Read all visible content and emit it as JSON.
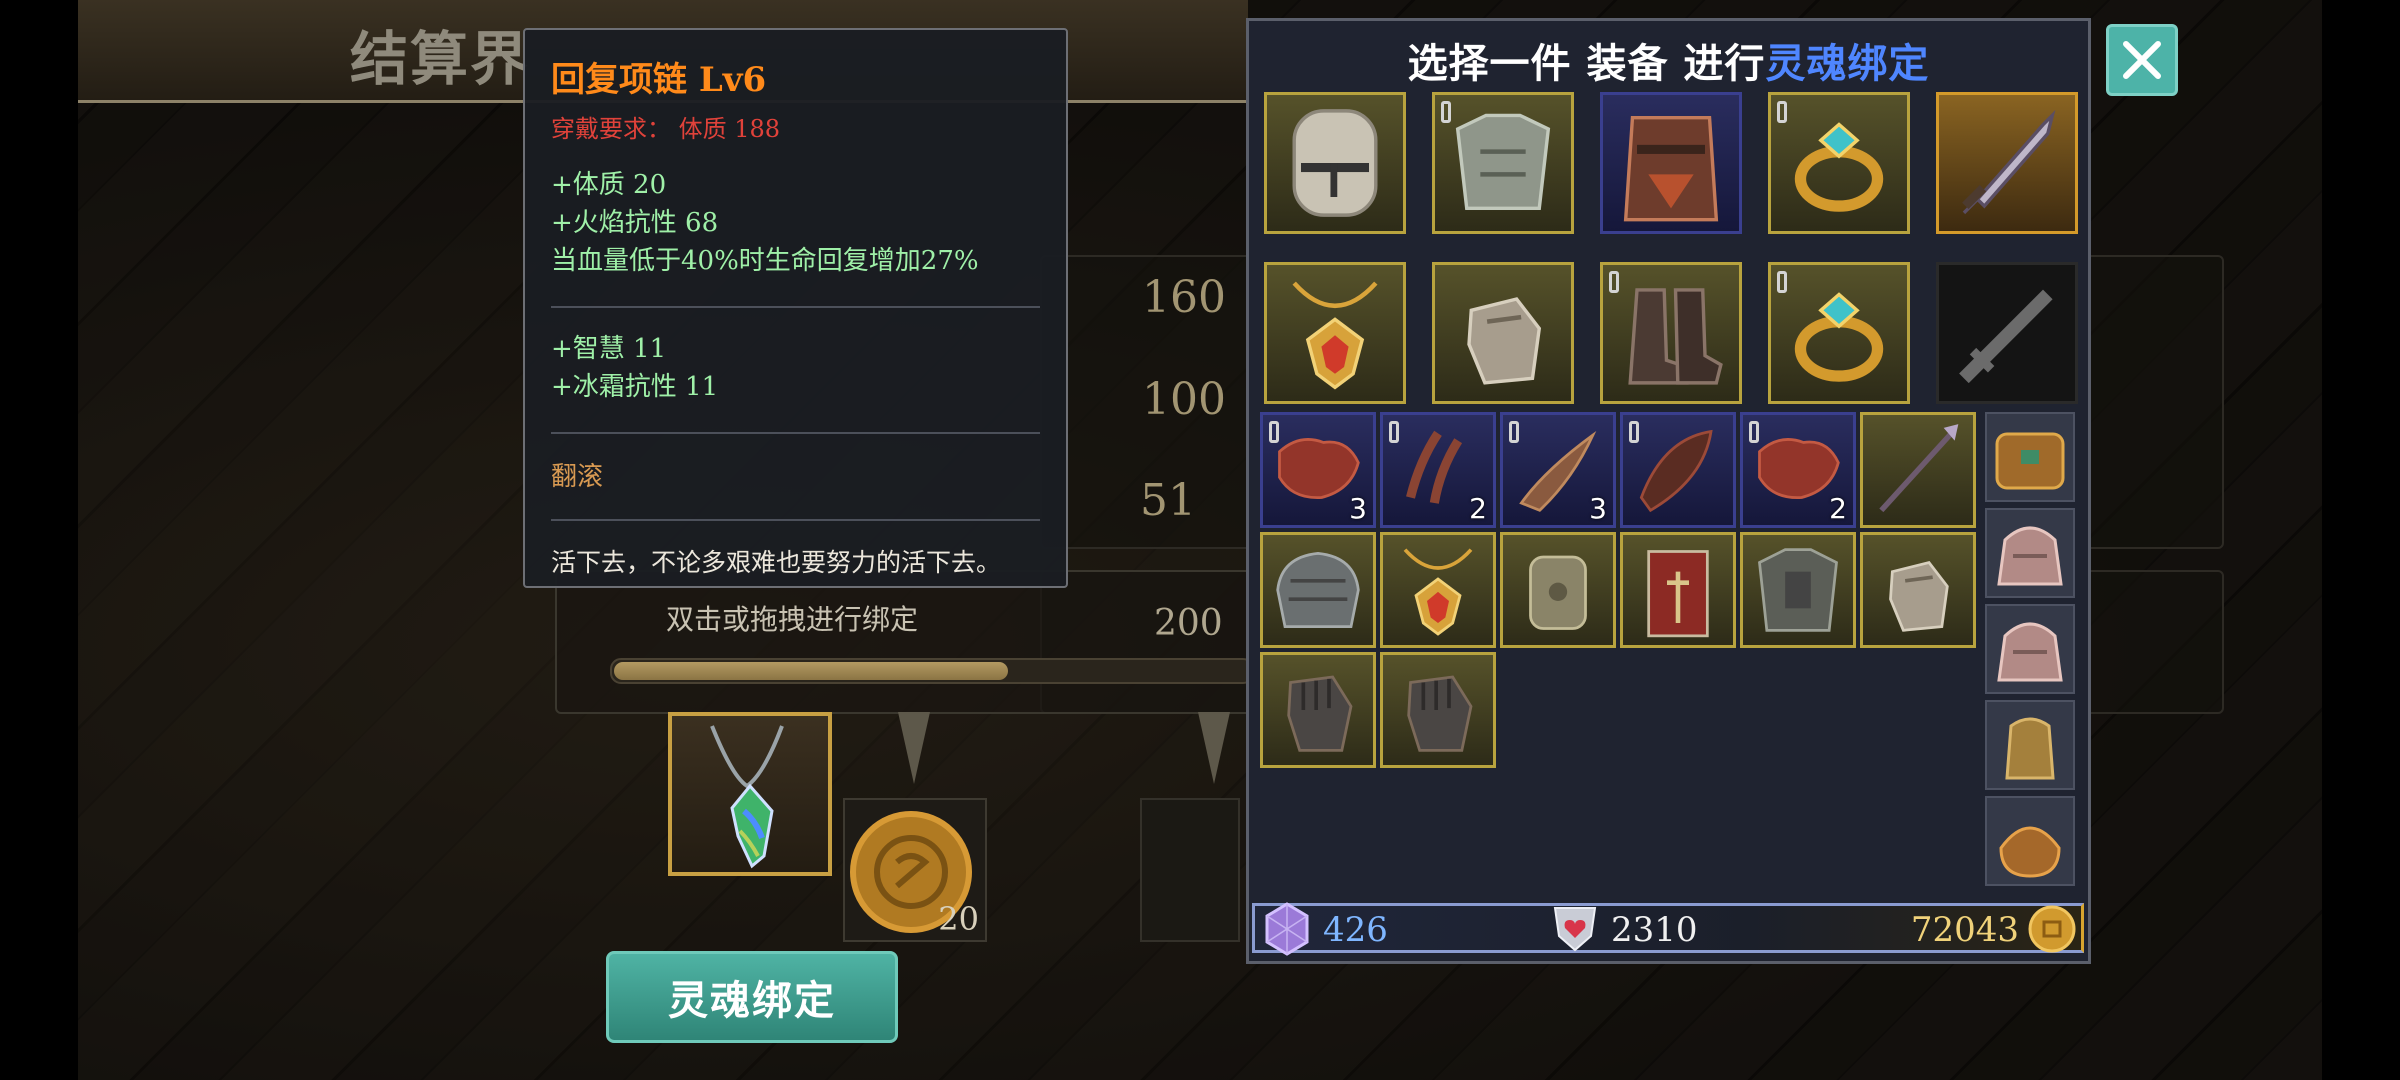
{
  "background_screen": {
    "title": "结算界",
    "numbers": [
      "160",
      "100",
      "51"
    ],
    "bind_hint": "双击或拖拽进行绑定",
    "progress_label": "200",
    "progress_fraction": 0.62,
    "coin_count": "20",
    "soul_bind_button": "灵魂绑定"
  },
  "tooltip": {
    "title": "回复项链  Lv6",
    "requirement": "穿戴要求：  体质  188",
    "stats": [
      "+体质  20",
      "+火焰抗性  68",
      "当血量低于40%时生命回复增加27%"
    ],
    "bonus_stats": [
      "+智慧  11",
      "+冰霜抗性  11"
    ],
    "skill": "翻滚",
    "flavor": "活下去，不论多艰难也要努力的活下去。"
  },
  "panel": {
    "title_prefix": "选择一件  装备  进行",
    "title_highlight": "灵魂绑定",
    "equipped": [
      {
        "icon": "great-helm-icon",
        "style": "olive"
      },
      {
        "icon": "chest-armor-icon",
        "style": "olive",
        "locked": true
      },
      {
        "icon": "leather-armor-icon",
        "style": "blue"
      },
      {
        "icon": "gem-ring-icon",
        "style": "olive",
        "locked": true
      },
      {
        "icon": "greatsword-icon",
        "style": "gold"
      },
      {
        "icon": "ruby-amulet-icon",
        "style": "olive"
      },
      {
        "icon": "gauntlet-icon",
        "style": "olive"
      },
      {
        "icon": "boots-icon",
        "style": "olive",
        "locked": true
      },
      {
        "icon": "gem-ring-icon",
        "style": "olive",
        "locked": true
      },
      {
        "icon": "sword-slot-icon",
        "style": "dark"
      }
    ],
    "inventory": [
      {
        "icon": "red-hide-icon",
        "style": "blue",
        "locked": true,
        "count": "3"
      },
      {
        "icon": "claws-icon",
        "style": "blue",
        "locked": true,
        "count": "2"
      },
      {
        "icon": "horn-icon",
        "style": "blue",
        "locked": true,
        "count": "3"
      },
      {
        "icon": "dark-hide-icon",
        "style": "blue",
        "locked": true,
        "count": ""
      },
      {
        "icon": "red-hide-icon",
        "style": "blue",
        "locked": true,
        "count": "2"
      },
      {
        "icon": "spear-icon",
        "style": "olive",
        "count": ""
      },
      {
        "icon": "shoulder-armor-icon",
        "style": "olive",
        "count": ""
      },
      {
        "icon": "ruby-amulet-icon",
        "style": "olive",
        "count": ""
      },
      {
        "icon": "bracer-icon",
        "style": "olive",
        "count": ""
      },
      {
        "icon": "tabard-icon",
        "style": "olive",
        "count": ""
      },
      {
        "icon": "plate-chest-icon",
        "style": "olive",
        "count": ""
      },
      {
        "icon": "gauntlet-icon",
        "style": "olive",
        "count": ""
      },
      {
        "icon": "dark-glove-icon",
        "style": "olive",
        "count": ""
      },
      {
        "icon": "dark-glove-icon",
        "style": "olive",
        "count": ""
      }
    ],
    "bag_tabs": [
      "chest-bag-icon",
      "pink-bag-icon",
      "pink-bag-icon",
      "small-bag-icon",
      "coin-pouch-icon"
    ],
    "currency": {
      "gems": "426",
      "hearts": "2310",
      "gold": "72043"
    }
  },
  "colors": {
    "highlight_blue": "#4f86ff",
    "title_orange": "#ff8a1a",
    "requirement_red": "#e0423a",
    "stat_green": "#9ff0a8",
    "button_teal": "#4db3a8"
  }
}
